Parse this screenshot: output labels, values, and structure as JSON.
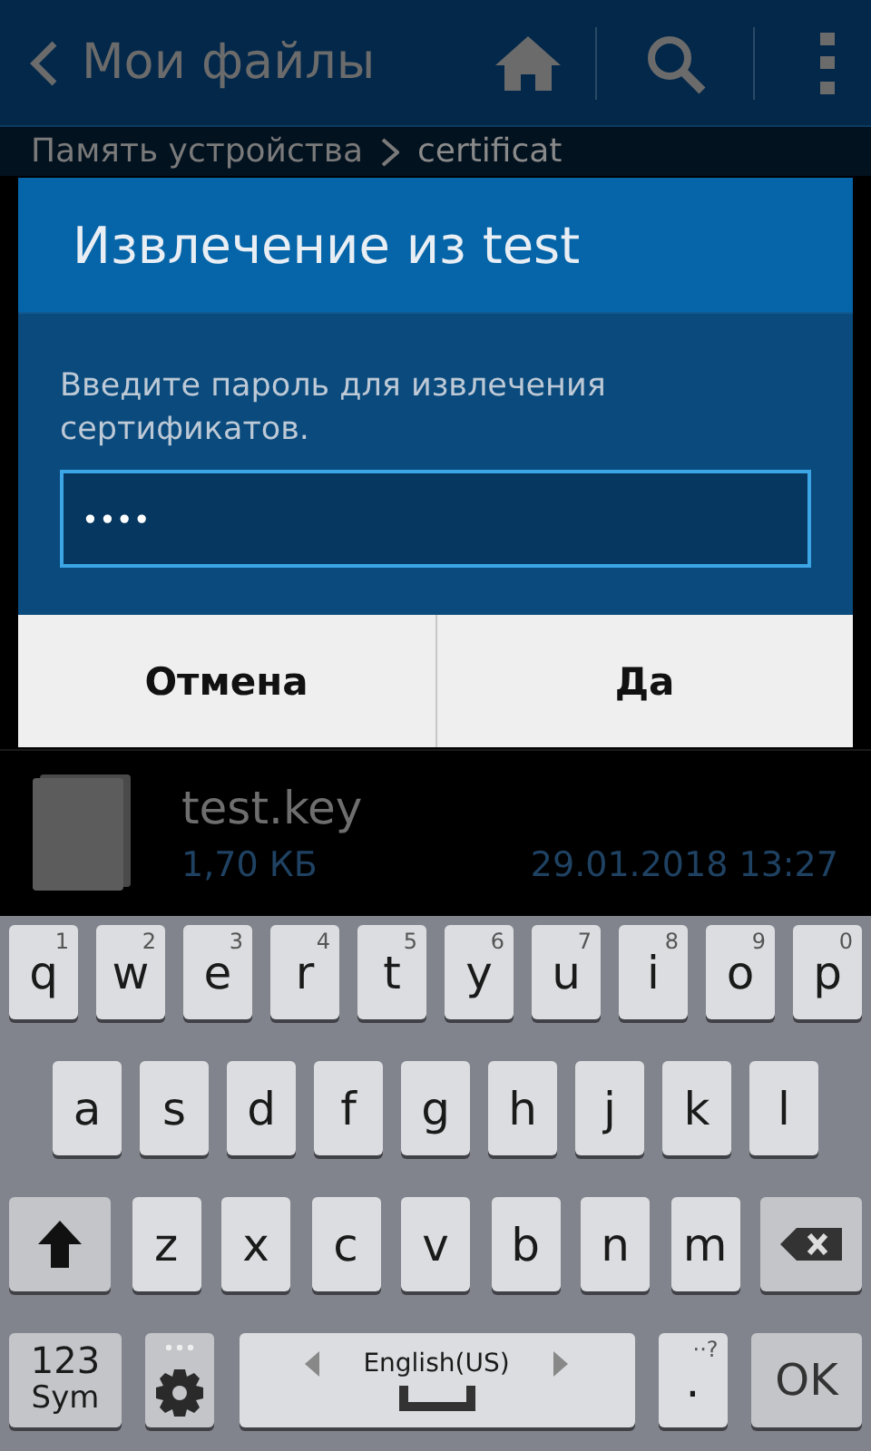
{
  "header": {
    "title": "Мои файлы"
  },
  "breadcrumb": [
    "Память устройства",
    "certificat"
  ],
  "files": [
    {
      "name": "test.key",
      "size": "1,70 КБ",
      "date": "29.01.2018 13:27"
    }
  ],
  "dialog": {
    "title": "Извлечение из test",
    "message": "Введите пароль для извлечения сертификатов.",
    "password": "••••",
    "buttons": [
      "Отмена",
      "Да"
    ]
  },
  "keyboard": {
    "row_1": [
      {
        "kind": "letter",
        "label": "q",
        "hint": "1"
      },
      {
        "kind": "letter",
        "label": "w",
        "hint": "2"
      },
      {
        "kind": "letter",
        "label": "e",
        "hint": "3"
      },
      {
        "kind": "letter",
        "label": "r",
        "hint": "4"
      },
      {
        "kind": "letter",
        "label": "t",
        "hint": "5"
      },
      {
        "kind": "letter",
        "label": "y",
        "hint": "6"
      },
      {
        "kind": "letter",
        "label": "u",
        "hint": "7"
      },
      {
        "kind": "letter",
        "label": "i",
        "hint": "8"
      },
      {
        "kind": "letter",
        "label": "o",
        "hint": "9"
      },
      {
        "kind": "letter",
        "label": "p",
        "hint": "0"
      }
    ],
    "row_2": [
      {
        "kind": "letter",
        "label": "a"
      },
      {
        "kind": "letter",
        "label": "s"
      },
      {
        "kind": "letter",
        "label": "d"
      },
      {
        "kind": "letter",
        "label": "f"
      },
      {
        "kind": "letter",
        "label": "g"
      },
      {
        "kind": "letter",
        "label": "h"
      },
      {
        "kind": "letter",
        "label": "j"
      },
      {
        "kind": "letter",
        "label": "k"
      },
      {
        "kind": "letter",
        "label": "l"
      }
    ],
    "row_3": [
      {
        "kind": "shift"
      },
      {
        "kind": "letter",
        "label": "z"
      },
      {
        "kind": "letter",
        "label": "x"
      },
      {
        "kind": "letter",
        "label": "c"
      },
      {
        "kind": "letter",
        "label": "v"
      },
      {
        "kind": "letter",
        "label": "b"
      },
      {
        "kind": "letter",
        "label": "n"
      },
      {
        "kind": "letter",
        "label": "m"
      },
      {
        "kind": "backspace"
      }
    ],
    "row_4": [
      {
        "kind": "symbols",
        "label": "123",
        "hint": "Sym"
      },
      {
        "kind": "settings"
      },
      {
        "kind": "space",
        "label": "English(US)"
      },
      {
        "kind": "letter",
        "label": ".",
        "hint": "··?"
      },
      {
        "kind": "ok",
        "label": "OK"
      }
    ]
  }
}
